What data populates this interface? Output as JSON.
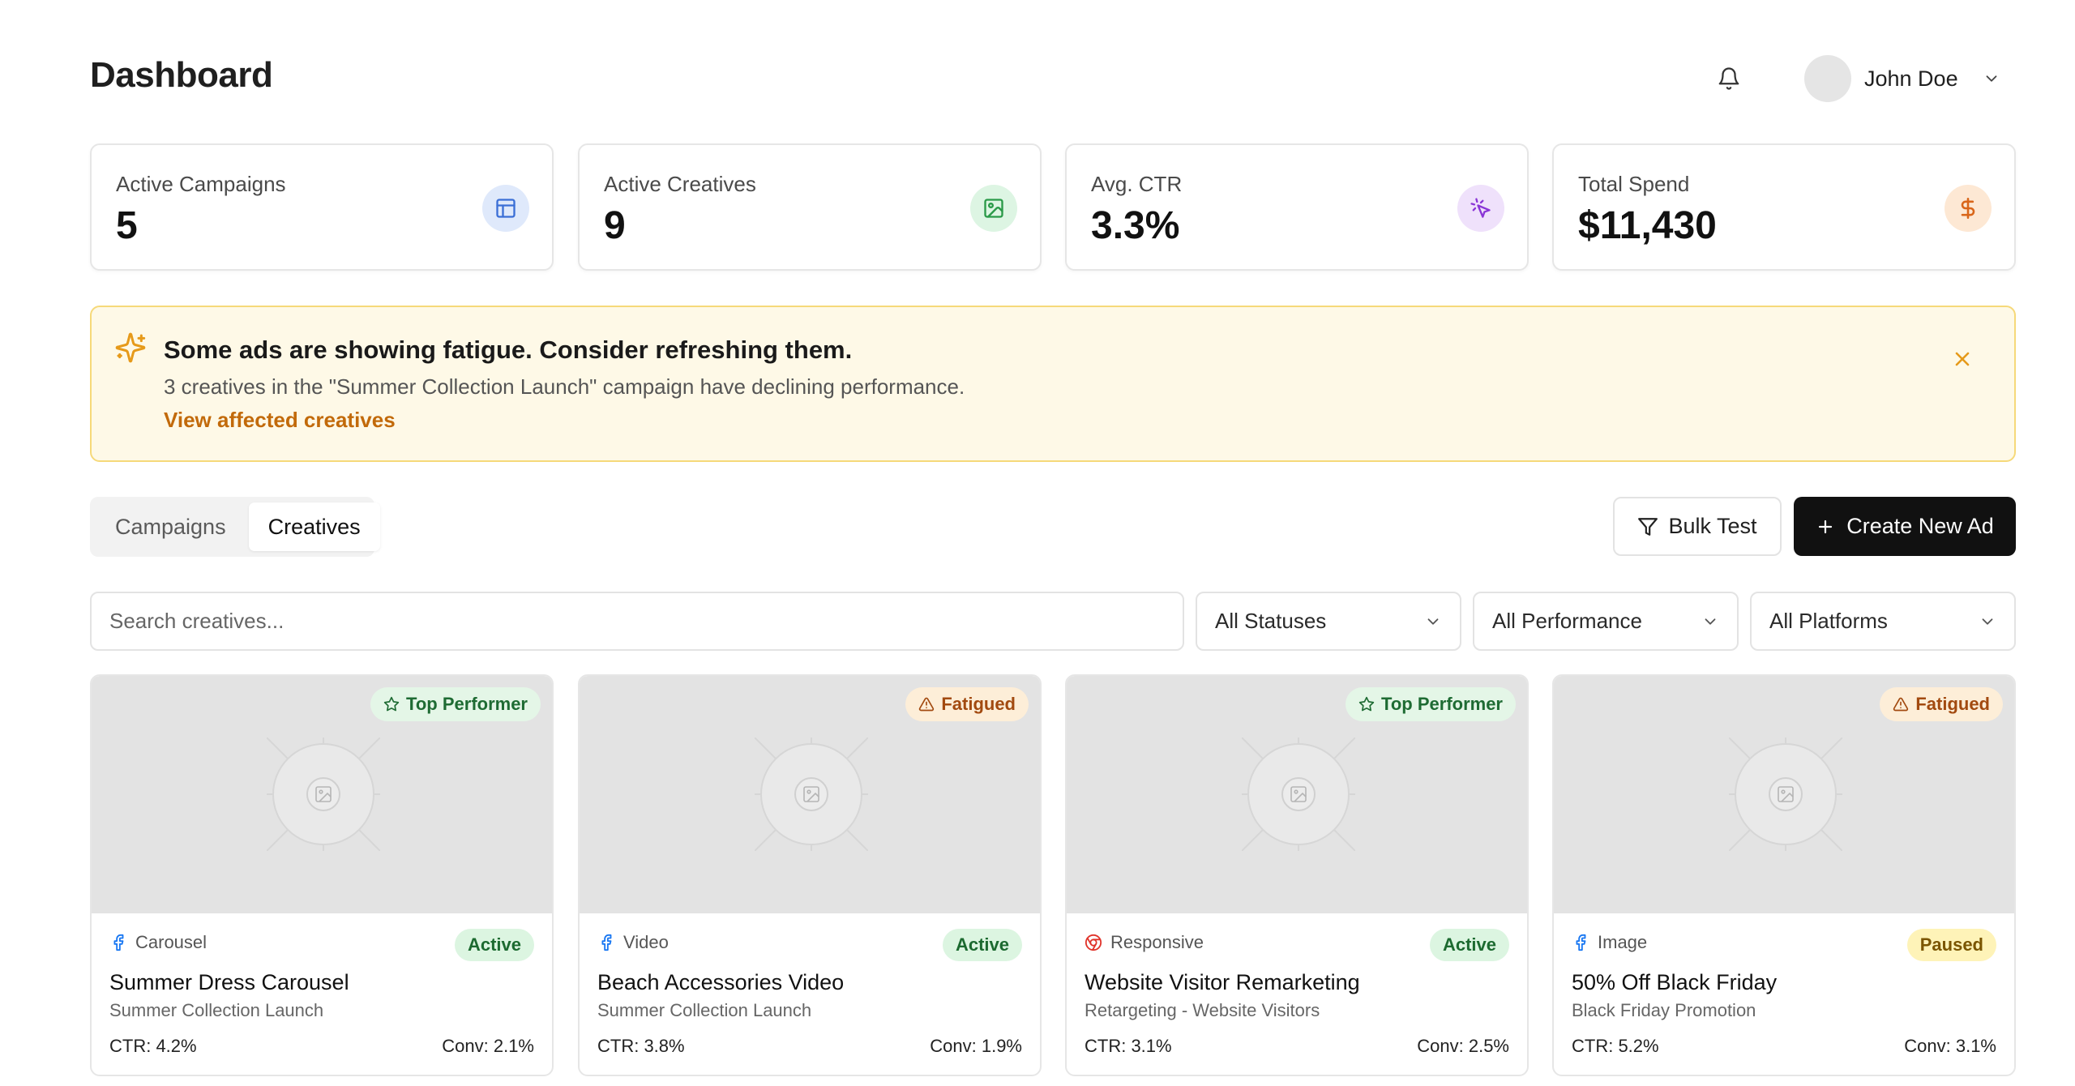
{
  "header": {
    "title": "Dashboard",
    "user_name": "John Doe"
  },
  "stats": [
    {
      "label": "Active Campaigns",
      "value": "5",
      "icon": "layout-icon",
      "icon_color": "#3b6fd6",
      "icon_bg": "#dfe9fb"
    },
    {
      "label": "Active Creatives",
      "value": "9",
      "icon": "image-icon",
      "icon_color": "#2a9a48",
      "icon_bg": "#ddf5e3"
    },
    {
      "label": "Avg. CTR",
      "value": "3.3%",
      "icon": "cursor-click-icon",
      "icon_color": "#8a35d6",
      "icon_bg": "#efe1fb"
    },
    {
      "label": "Total Spend",
      "value": "$11,430",
      "icon": "dollar-icon",
      "icon_color": "#d9661a",
      "icon_bg": "#fde8d4"
    }
  ],
  "alert": {
    "title": "Some ads are showing fatigue. Consider refreshing them.",
    "description": "3 creatives in the \"Summer Collection Launch\" campaign have declining performance.",
    "link": "View affected creatives",
    "icon": "sparkles-icon",
    "accent": "#e69a1a"
  },
  "tabs": [
    {
      "label": "Campaigns",
      "active": false
    },
    {
      "label": "Creatives",
      "active": true
    }
  ],
  "actions": {
    "bulk_test": "Bulk Test",
    "create_new_ad": "Create New Ad"
  },
  "filters": {
    "search_placeholder": "Search creatives...",
    "status": "All Statuses",
    "performance": "All Performance",
    "platforms": "All Platforms"
  },
  "creatives": [
    {
      "badge": "Top Performer",
      "badge_type": "top",
      "platform_icon": "facebook-icon",
      "format": "Carousel",
      "status": "Active",
      "status_type": "active",
      "title": "Summer Dress Carousel",
      "campaign": "Summer Collection Launch",
      "ctr": "CTR: 4.2%",
      "conv": "Conv: 2.1%"
    },
    {
      "badge": "Fatigued",
      "badge_type": "fat",
      "platform_icon": "facebook-icon",
      "format": "Video",
      "status": "Active",
      "status_type": "active",
      "title": "Beach Accessories Video",
      "campaign": "Summer Collection Launch",
      "ctr": "CTR: 3.8%",
      "conv": "Conv: 1.9%"
    },
    {
      "badge": "Top Performer",
      "badge_type": "top",
      "platform_icon": "chrome-icon",
      "format": "Responsive",
      "status": "Active",
      "status_type": "active",
      "title": "Website Visitor Remarketing",
      "campaign": "Retargeting - Website Visitors",
      "ctr": "CTR: 3.1%",
      "conv": "Conv: 2.5%"
    },
    {
      "badge": "Fatigued",
      "badge_type": "fat",
      "platform_icon": "facebook-icon",
      "format": "Image",
      "status": "Paused",
      "status_type": "paused",
      "title": "50% Off Black Friday",
      "campaign": "Black Friday Promotion",
      "ctr": "CTR: 5.2%",
      "conv": "Conv: 3.1%"
    }
  ]
}
